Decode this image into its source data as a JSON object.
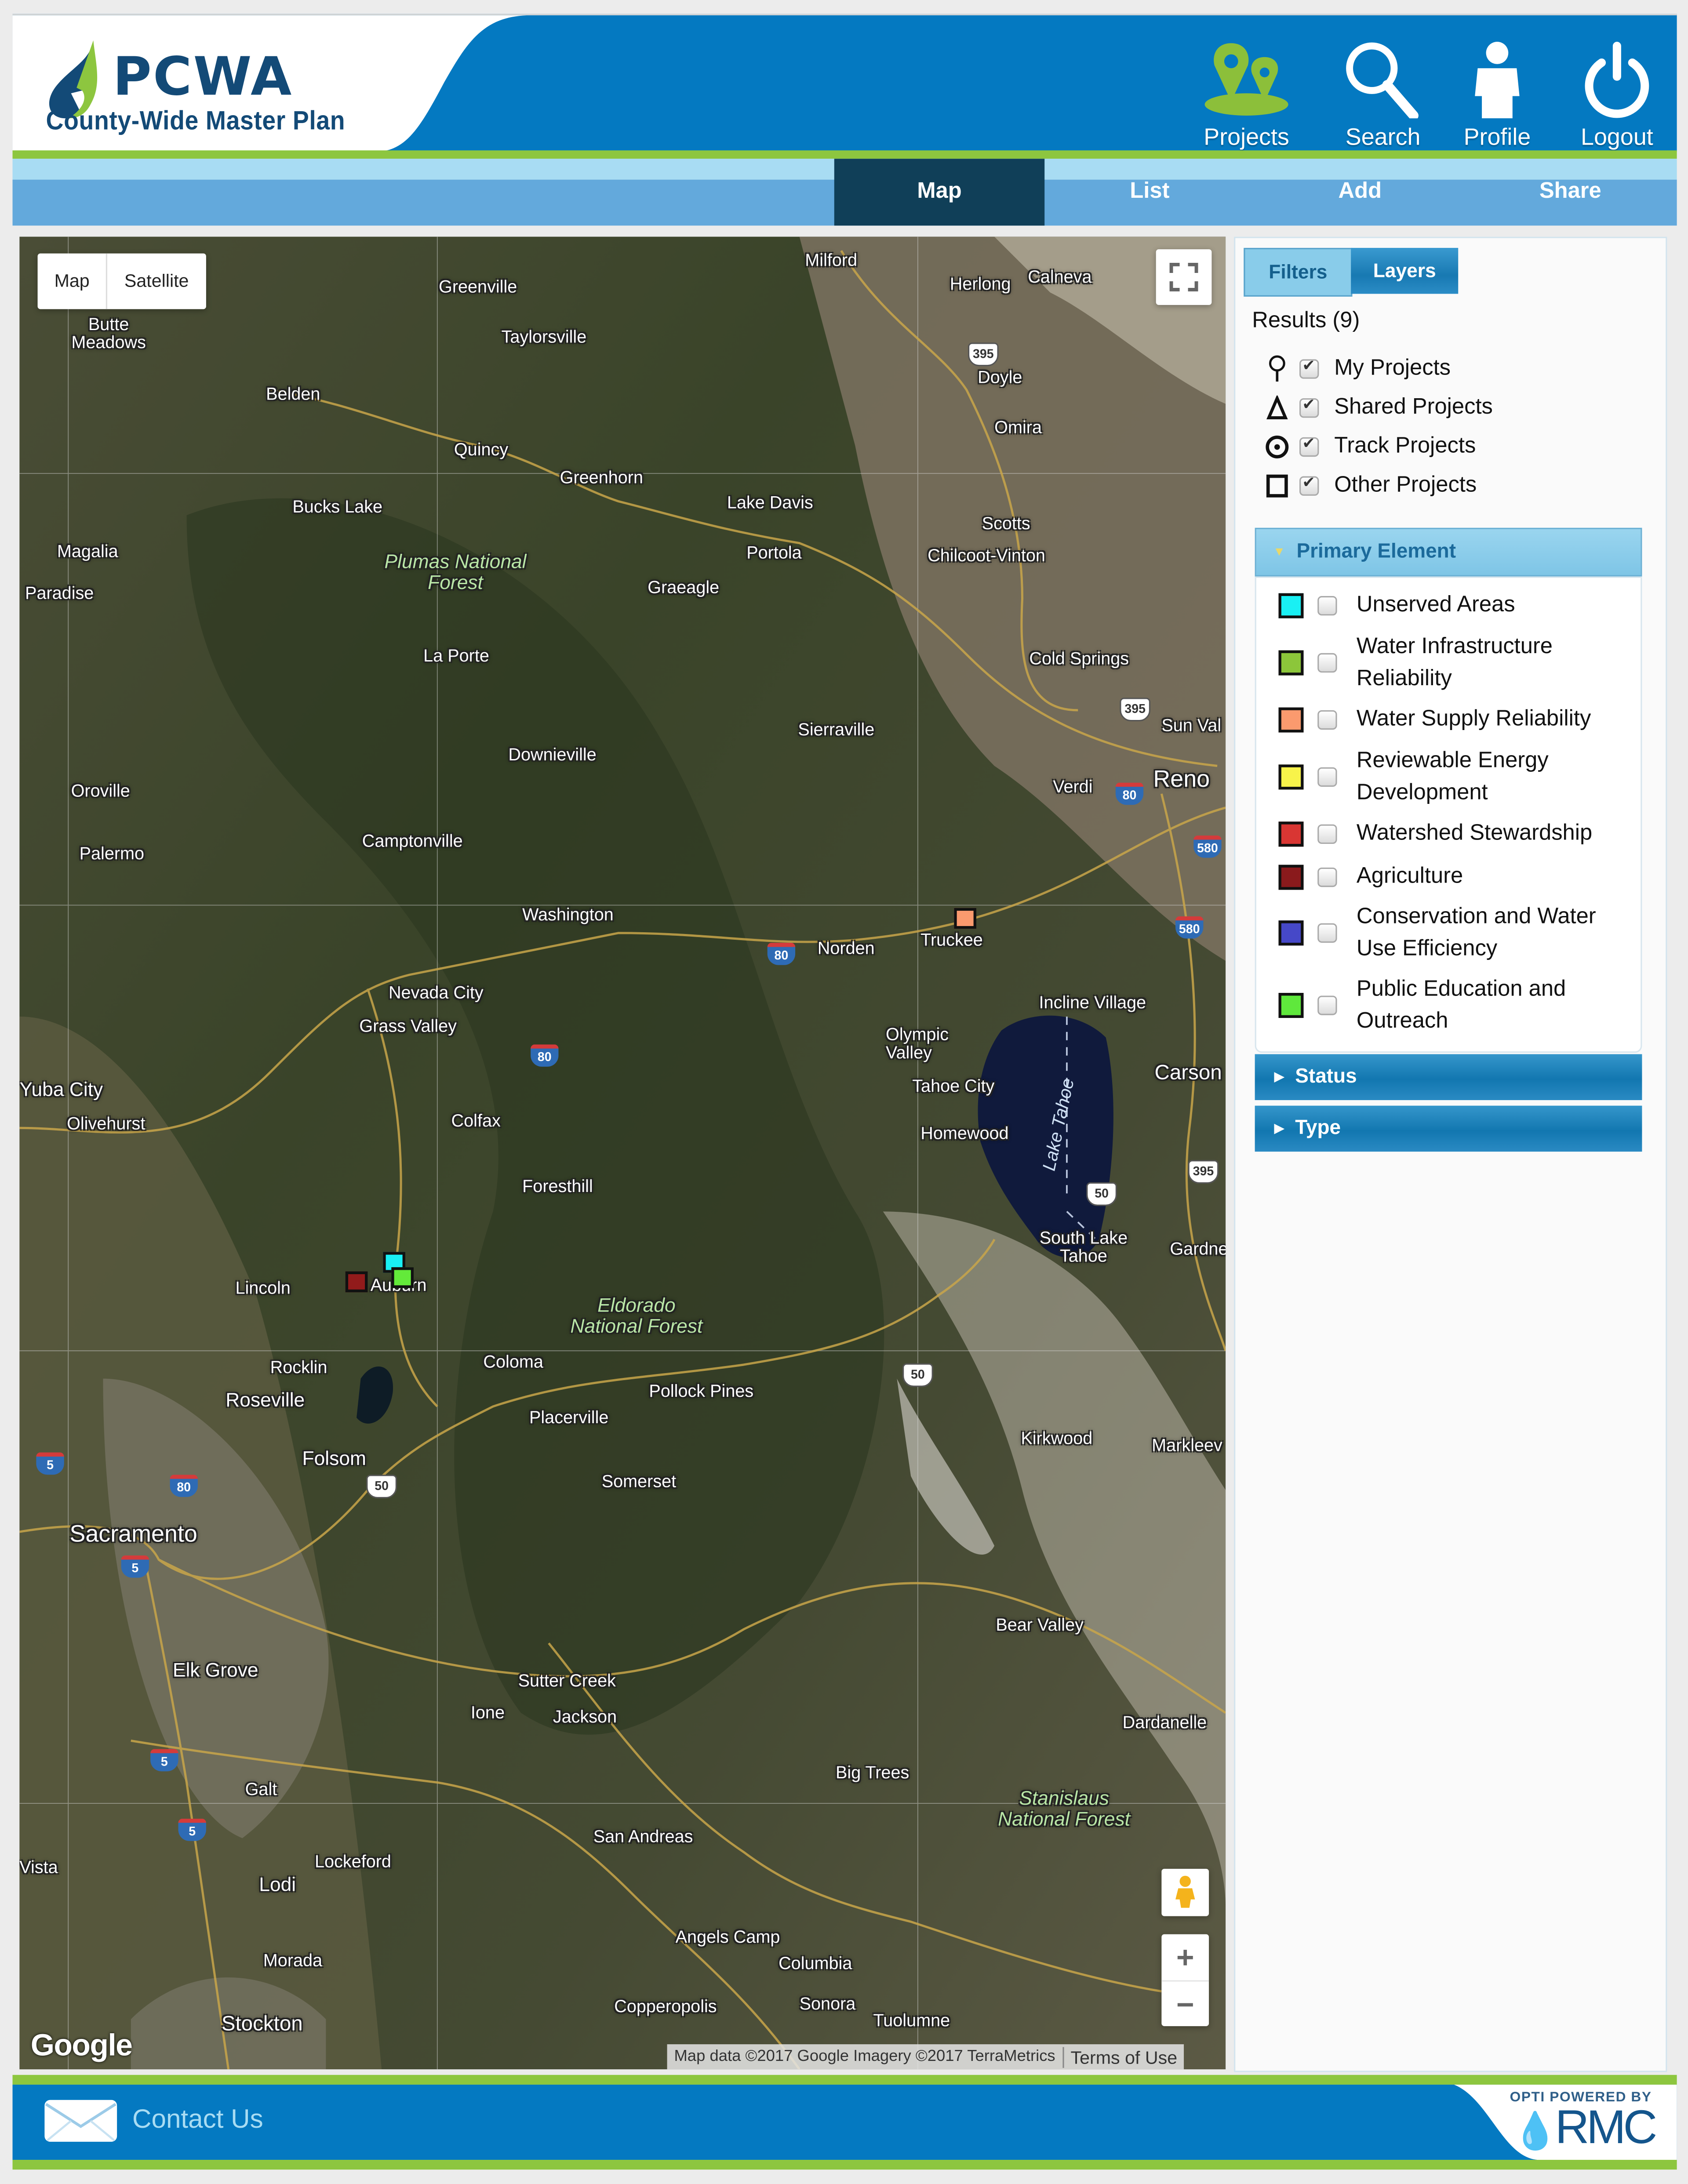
{
  "header": {
    "logo_title": "PCWA",
    "logo_subtitle": "County-Wide Master Plan",
    "nav": [
      {
        "label": "Projects",
        "icon": "map-pins-icon"
      },
      {
        "label": "Search",
        "icon": "magnifier-icon"
      },
      {
        "label": "Profile",
        "icon": "person-icon"
      },
      {
        "label": "Logout",
        "icon": "power-icon"
      }
    ]
  },
  "tabs": [
    {
      "label": "Map",
      "active": true
    },
    {
      "label": "List",
      "active": false
    },
    {
      "label": "Add",
      "active": false
    },
    {
      "label": "Share",
      "active": false
    }
  ],
  "map": {
    "type_buttons": {
      "map": "Map",
      "satellite": "Satellite"
    },
    "zoom_in": "+",
    "zoom_out": "−",
    "google_logo": "Google",
    "attribution": "Map data ©2017 Google Imagery ©2017 TerraMetrics",
    "terms": "Terms of Use",
    "labels": [
      {
        "text": "Milford"
      },
      {
        "text": "Herlong"
      },
      {
        "text": "Calneva"
      },
      {
        "text": "Greenville"
      },
      {
        "text": "Butte Meadows"
      },
      {
        "text": "Taylorsville"
      },
      {
        "text": "Doyle"
      },
      {
        "text": "Belden"
      },
      {
        "text": "Omira"
      },
      {
        "text": "Quincy"
      },
      {
        "text": "Greenhorn"
      },
      {
        "text": "Bucks Lake"
      },
      {
        "text": "Lake Davis"
      },
      {
        "text": "Scotts"
      },
      {
        "text": "Magalia"
      },
      {
        "text": "Portola"
      },
      {
        "text": "Chilcoot-Vinton"
      },
      {
        "text": "Paradise"
      },
      {
        "text": "Graeagle"
      },
      {
        "text": "La Porte"
      },
      {
        "text": "Cold Springs"
      },
      {
        "text": "Sun Val"
      },
      {
        "text": "Sierraville"
      },
      {
        "text": "Downieville"
      },
      {
        "text": "Reno"
      },
      {
        "text": "Verdi"
      },
      {
        "text": "Oroville"
      },
      {
        "text": "Camptonville"
      },
      {
        "text": "Palermo"
      },
      {
        "text": "Washington"
      },
      {
        "text": "Norden"
      },
      {
        "text": "Truckee"
      },
      {
        "text": "Nevada City"
      },
      {
        "text": "Incline Village"
      },
      {
        "text": "Grass Valley"
      },
      {
        "text": "Olympic Valley"
      },
      {
        "text": "Yuba City"
      },
      {
        "text": "Tahoe City"
      },
      {
        "text": "Carson"
      },
      {
        "text": "Olivehurst"
      },
      {
        "text": "Colfax"
      },
      {
        "text": "Homewood"
      },
      {
        "text": "Foresthill"
      },
      {
        "text": "South Lake Tahoe"
      },
      {
        "text": "Gardne"
      },
      {
        "text": "Lincoln"
      },
      {
        "text": "Auburn"
      },
      {
        "text": "Coloma"
      },
      {
        "text": "Rocklin"
      },
      {
        "text": "Pollock Pines"
      },
      {
        "text": "Roseville"
      },
      {
        "text": "Placerville"
      },
      {
        "text": "Kirkwood"
      },
      {
        "text": "Markleev"
      },
      {
        "text": "Folsom"
      },
      {
        "text": "Somerset"
      },
      {
        "text": "Sacramento"
      },
      {
        "text": "Bear Valley"
      },
      {
        "text": "Elk Grove"
      },
      {
        "text": "Sutter Creek"
      },
      {
        "text": "Ione"
      },
      {
        "text": "Jackson"
      },
      {
        "text": "Dardanelle"
      },
      {
        "text": "Big Trees"
      },
      {
        "text": "Galt"
      },
      {
        "text": "San Andreas"
      },
      {
        "text": "Lockeford"
      },
      {
        "text": "Lodi"
      },
      {
        "text": "Angels Camp"
      },
      {
        "text": "Columbia"
      },
      {
        "text": "Morada"
      },
      {
        "text": "Sonora"
      },
      {
        "text": "Stockton"
      },
      {
        "text": "Tuolumne"
      },
      {
        "text": "Copperopolis"
      },
      {
        "text": "Vista"
      }
    ],
    "parks": [
      {
        "text": "Plumas National Forest"
      },
      {
        "text": "Eldorado National Forest"
      },
      {
        "text": "Stanislaus National Forest"
      }
    ],
    "lake": "Lake Tahoe",
    "shields": [
      {
        "type": "us",
        "num": "395"
      },
      {
        "type": "us",
        "num": "395"
      },
      {
        "type": "us",
        "num": "395"
      },
      {
        "type": "i",
        "num": "80"
      },
      {
        "type": "i",
        "num": "580"
      },
      {
        "type": "i",
        "num": "580"
      },
      {
        "type": "i",
        "num": "80"
      },
      {
        "type": "i",
        "num": "80"
      },
      {
        "type": "us",
        "num": "50"
      },
      {
        "type": "us",
        "num": "50"
      },
      {
        "type": "us",
        "num": "50"
      },
      {
        "type": "i",
        "num": "5"
      },
      {
        "type": "i",
        "num": "80"
      },
      {
        "type": "i",
        "num": "5"
      },
      {
        "type": "i",
        "num": "5"
      },
      {
        "type": "i",
        "num": "5"
      }
    ],
    "markers": [
      {
        "category": "Unserved Areas",
        "color": "#19f0f4",
        "near": "Auburn"
      },
      {
        "category": "Public Education and Outreach",
        "color": "#63ea3a",
        "near": "Auburn"
      },
      {
        "category": "Agriculture",
        "color": "#921b1b",
        "near": "Auburn"
      },
      {
        "category": "Water Supply Reliability",
        "color": "#fb9a6e",
        "near": "Truckee"
      }
    ]
  },
  "panel": {
    "tabs": {
      "filters": "Filters",
      "layers": "Layers"
    },
    "results_label": "Results (9)",
    "project_types": [
      {
        "label": "My Projects",
        "icon": "pin-outline-icon",
        "checked": true
      },
      {
        "label": "Shared Projects",
        "icon": "triangle-outline-icon",
        "checked": true
      },
      {
        "label": "Track Projects",
        "icon": "target-circle-icon",
        "checked": true
      },
      {
        "label": "Other Projects",
        "icon": "square-outline-icon",
        "checked": true
      }
    ],
    "primary_element": {
      "title": "Primary Element",
      "expanded": true,
      "items": [
        {
          "label": "Unserved Areas",
          "color": "#19f0f4",
          "checked": false
        },
        {
          "label": "Water Infrastructure Reliability",
          "color": "#8cc63a",
          "checked": false
        },
        {
          "label": "Water Supply Reliability",
          "color": "#fb9a6e",
          "checked": false
        },
        {
          "label": "Reviewable Energy Development",
          "color": "#f8f34a",
          "checked": false
        },
        {
          "label": "Watershed Stewardship",
          "color": "#d93633",
          "checked": false
        },
        {
          "label": "Agriculture",
          "color": "#8a1a1c",
          "checked": false
        },
        {
          "label": "Conservation and Water Use Efficiency",
          "color": "#4648c8",
          "checked": false
        },
        {
          "label": "Public Education and Outreach",
          "color": "#5fe83c",
          "checked": false
        }
      ]
    },
    "status": {
      "title": "Status",
      "expanded": false
    },
    "type": {
      "title": "Type",
      "expanded": false
    }
  },
  "footer": {
    "contact_label": "Contact Us",
    "powered_by": "OPTI POWERED BY",
    "brand": "RMC"
  },
  "colors": {
    "brand_blue": "#0479c1",
    "brand_green": "#8dc63f",
    "tab_active": "#103f58",
    "tab_bar": "#63a9dc",
    "logo_navy": "#134a77"
  }
}
